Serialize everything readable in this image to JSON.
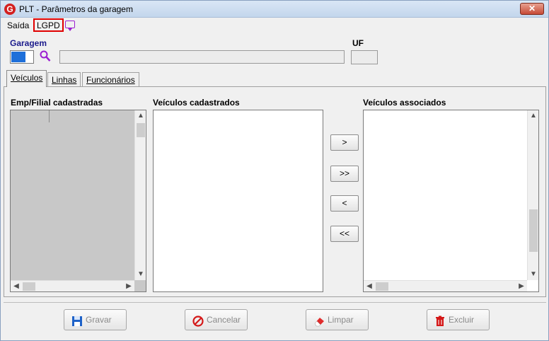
{
  "window": {
    "title": "PLT - Parâmetros da garagem",
    "close_label": "✕",
    "app_icon": "G"
  },
  "menu": {
    "saida": "Saída",
    "lgpd": "LGPD"
  },
  "form": {
    "garagem_label": "Garagem",
    "uf_label": "UF",
    "garagem_code": "",
    "garagem_desc": "",
    "uf_value": ""
  },
  "tabs": [
    {
      "label": "Veículos",
      "active": true
    },
    {
      "label": "Linhas",
      "active": false
    },
    {
      "label": "Funcionários",
      "active": false
    }
  ],
  "lists": {
    "emp_filial": "Emp/Filial cadastradas",
    "veiculos_cadastrados": "Veículos cadastrados",
    "veiculos_associados": "Veículos associados"
  },
  "move_buttons": {
    "add": ">",
    "add_all": ">>",
    "remove": "<",
    "remove_all": "<<"
  },
  "actions": {
    "gravar": "Gravar",
    "cancelar": "Cancelar",
    "limpar": "Limpar",
    "excluir": "Excluir"
  },
  "icons": {
    "app": "app-logo-icon",
    "chat": "chat-icon",
    "search": "search-icon"
  },
  "colors": {
    "accent_blue": "#1b1b8c",
    "highlight_red": "#e00000",
    "icon_purple": "#9b1fd1"
  }
}
